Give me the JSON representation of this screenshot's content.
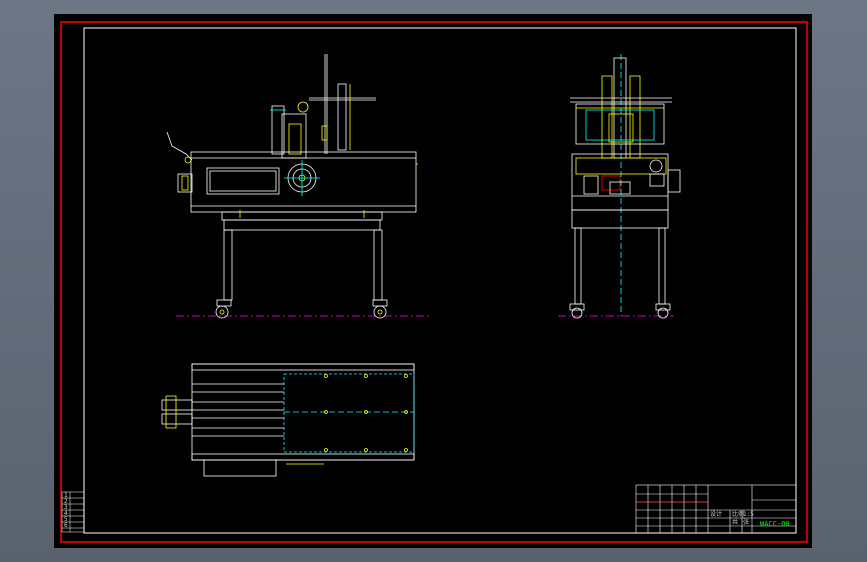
{
  "drawing": {
    "title_block": {
      "drawing_number": "WACC-00",
      "cells": [
        "设计",
        "比例",
        "1:5",
        "共",
        "张"
      ]
    },
    "revision_rows": [
      "1",
      "2",
      "3",
      "4",
      "5",
      "6"
    ],
    "colors": {
      "background": "#000000",
      "border_red": "#ff0000",
      "outline": "#ffffff",
      "centerline": "#ff00ff",
      "hidden": "#00ffff",
      "accent": "#ffff00",
      "green": "#00ff00"
    },
    "views": [
      "front-elevation",
      "side-elevation",
      "top-plan"
    ]
  }
}
